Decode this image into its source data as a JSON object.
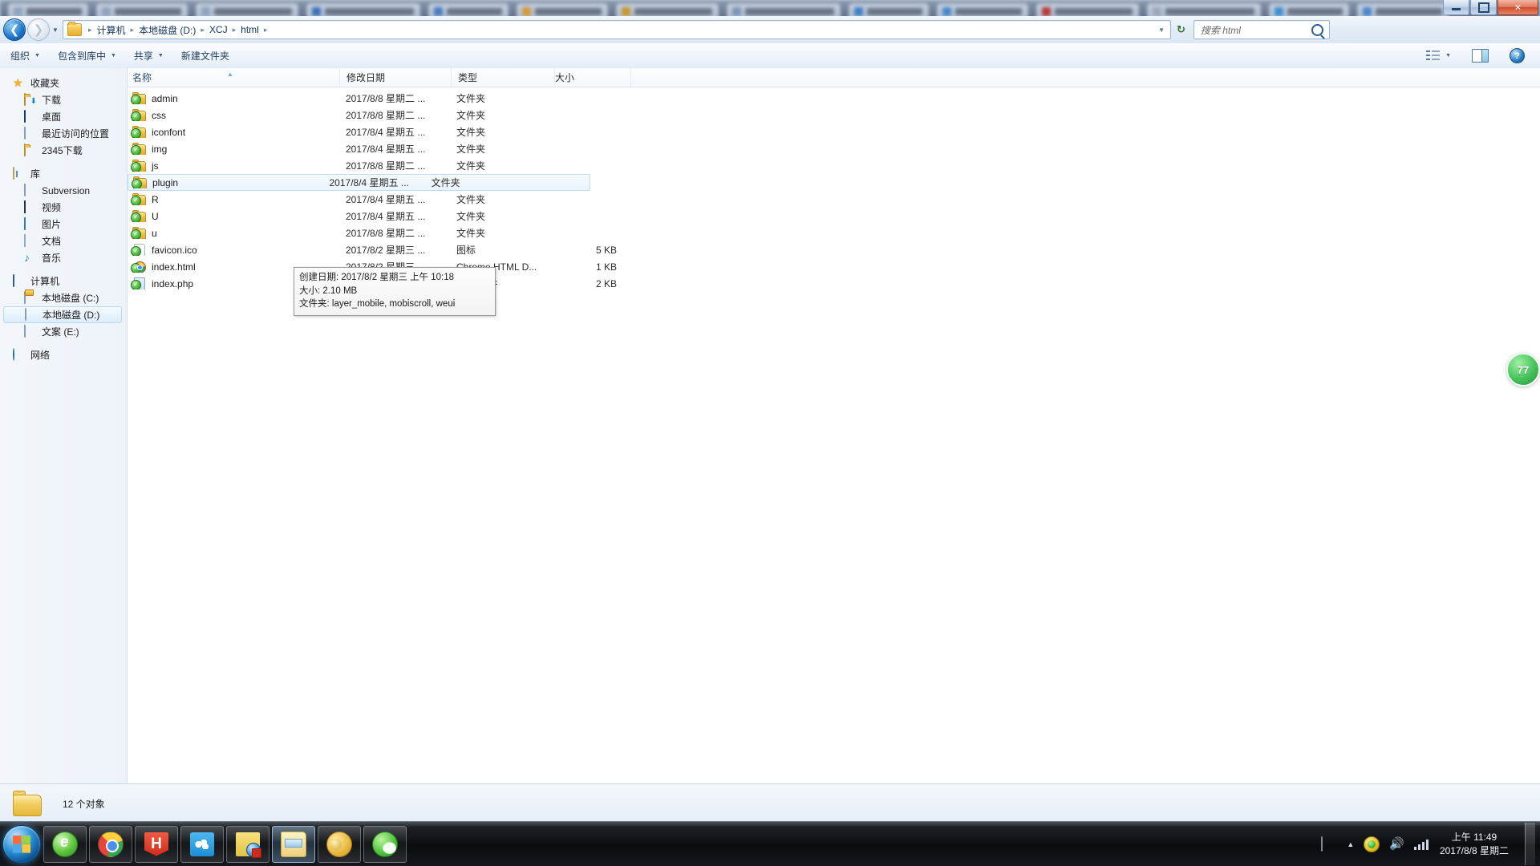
{
  "background_browser": {
    "tab_count": 14
  },
  "window": {
    "controls": {
      "minimize_label": "最小化",
      "restore_label": "向下还原",
      "close_label": "关闭"
    }
  },
  "nav": {
    "back_label": "后退",
    "forward_label": "前进",
    "recent_pages_label": "最近浏览的页面",
    "breadcrumbs": [
      "计算机",
      "本地磁盘 (D:)",
      "XCJ",
      "html"
    ],
    "separator": "▶",
    "refresh_label": "刷新",
    "search": {
      "placeholder": "搜索 html",
      "value": ""
    }
  },
  "toolbar": {
    "items": [
      {
        "label": "组织",
        "caret": true
      },
      {
        "label": "包含到库中",
        "caret": true
      },
      {
        "label": "共享",
        "caret": true
      },
      {
        "label": "新建文件夹",
        "caret": false
      }
    ],
    "view_label": "更改您的视图",
    "preview_label": "显示预览窗格",
    "help_label": "获取帮助"
  },
  "sidebar": {
    "groups": [
      {
        "header": {
          "label": "收藏夹",
          "icon": "star-icon"
        },
        "items": [
          {
            "label": "下载",
            "icon": "download-folder-icon"
          },
          {
            "label": "桌面",
            "icon": "desktop-icon"
          },
          {
            "label": "最近访问的位置",
            "icon": "recent-places-icon"
          },
          {
            "label": "2345下载",
            "icon": "folder-icon"
          }
        ]
      },
      {
        "header": {
          "label": "库",
          "icon": "library-icon"
        },
        "items": [
          {
            "label": "Subversion",
            "icon": "subversion-icon"
          },
          {
            "label": "视频",
            "icon": "video-icon"
          },
          {
            "label": "图片",
            "icon": "pictures-icon"
          },
          {
            "label": "文档",
            "icon": "documents-icon"
          },
          {
            "label": "音乐",
            "icon": "music-icon"
          }
        ]
      },
      {
        "header": {
          "label": "计算机",
          "icon": "computer-icon"
        },
        "items": [
          {
            "label": "本地磁盘 (C:)",
            "icon": "system-drive-icon",
            "selected": false
          },
          {
            "label": "本地磁盘 (D:)",
            "icon": "drive-icon",
            "selected": true
          },
          {
            "label": "文案 (E:)",
            "icon": "drive-icon",
            "selected": false
          }
        ]
      },
      {
        "header": {
          "label": "网络",
          "icon": "network-icon"
        },
        "items": []
      }
    ]
  },
  "filelist": {
    "columns": [
      {
        "key": "name",
        "label": "名称",
        "sorted": "asc"
      },
      {
        "key": "date",
        "label": "修改日期"
      },
      {
        "key": "type",
        "label": "类型"
      },
      {
        "key": "size",
        "label": "大小"
      }
    ],
    "rows": [
      {
        "name": "admin",
        "date": "2017/8/8 星期二 ...",
        "type": "文件夹",
        "size": "",
        "icon": "folder-svn-icon",
        "selected": false
      },
      {
        "name": "css",
        "date": "2017/8/8 星期二 ...",
        "type": "文件夹",
        "size": "",
        "icon": "folder-svn-icon",
        "selected": false
      },
      {
        "name": "iconfont",
        "date": "2017/8/4 星期五 ...",
        "type": "文件夹",
        "size": "",
        "icon": "folder-svn-icon",
        "selected": false
      },
      {
        "name": "img",
        "date": "2017/8/4 星期五 ...",
        "type": "文件夹",
        "size": "",
        "icon": "folder-svn-icon",
        "selected": false
      },
      {
        "name": "js",
        "date": "2017/8/8 星期二 ...",
        "type": "文件夹",
        "size": "",
        "icon": "folder-svn-icon",
        "selected": false
      },
      {
        "name": "plugin",
        "date": "2017/8/4 星期五 ...",
        "type": "文件夹",
        "size": "",
        "icon": "folder-svn-icon",
        "selected": true
      },
      {
        "name": "R",
        "date": "2017/8/4 星期五 ...",
        "type": "文件夹",
        "size": "",
        "icon": "folder-svn-icon",
        "selected": false
      },
      {
        "name": "U",
        "date": "2017/8/4 星期五 ...",
        "type": "文件夹",
        "size": "",
        "icon": "folder-svn-icon",
        "selected": false
      },
      {
        "name": "u",
        "date": "2017/8/8 星期二 ...",
        "type": "文件夹",
        "size": "",
        "icon": "folder-svn-icon",
        "selected": false
      },
      {
        "name": "favicon.ico",
        "date": "2017/8/2 星期三 ...",
        "type": "图标",
        "size": "5 KB",
        "icon": "ico-file-icon",
        "selected": false
      },
      {
        "name": "index.html",
        "date": "2017/8/2 星期三 ...",
        "type": "Chrome HTML D...",
        "size": "1 KB",
        "icon": "chrome-file-icon",
        "selected": false
      },
      {
        "name": "index.php",
        "date": "2017/8/2 星期三 ...",
        "type": "PHP 文件",
        "size": "2 KB",
        "icon": "php-file-icon",
        "selected": false
      }
    ]
  },
  "tooltip": {
    "lines": [
      "创建日期: 2017/8/2 星期三 上午 10:18",
      "大小: 2.10 MB",
      "文件夹: layer_mobile, mobiscroll, weui"
    ]
  },
  "statusbar": {
    "text": "12 个对象",
    "icon": "folder-icon"
  },
  "float_ball": {
    "value": "77"
  },
  "taskbar": {
    "start_label": "开始",
    "buttons": [
      {
        "name": "browser-360",
        "icon": "360-browser-icon",
        "active": false
      },
      {
        "name": "chrome",
        "icon": "chrome-icon",
        "active": false
      },
      {
        "name": "hbuilder",
        "icon": "hbuilder-icon",
        "active": false
      },
      {
        "name": "baidu-netdisk",
        "icon": "baidu-netdisk-icon",
        "active": false
      },
      {
        "name": "tortoise-svn",
        "icon": "tortoisesvn-icon",
        "active": false
      },
      {
        "name": "explorer",
        "icon": "explorer-icon",
        "active": true
      },
      {
        "name": "winrar",
        "icon": "winrar-icon",
        "active": false
      },
      {
        "name": "wechat",
        "icon": "wechat-icon",
        "active": false
      }
    ],
    "tray": {
      "keyboard_label": "输入法",
      "expand_label": "显示隐藏的图标",
      "security_label": "360安全卫士",
      "volume_label": "音量",
      "network_label": "网络",
      "clock_time": "上午 11:49",
      "clock_date": "2017/8/8 星期二",
      "show_desktop_label": "显示桌面"
    }
  }
}
